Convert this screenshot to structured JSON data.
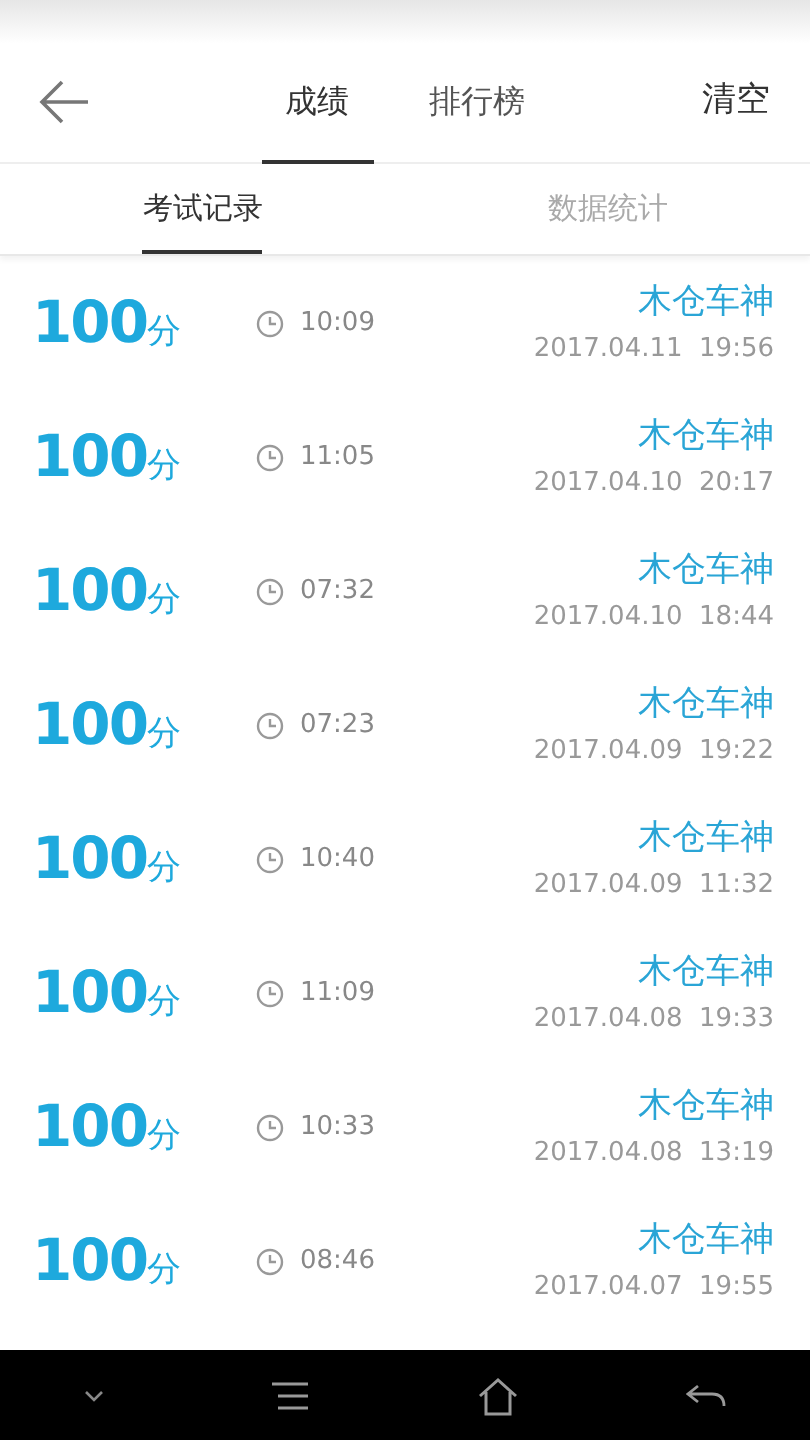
{
  "header": {
    "tabs": [
      {
        "label": "成绩",
        "selected": true
      },
      {
        "label": "排行榜",
        "selected": false
      }
    ],
    "action": "清空"
  },
  "subtabs": [
    {
      "label": "考试记录",
      "selected": true
    },
    {
      "label": "数据统计",
      "selected": false
    }
  ],
  "records": [
    {
      "score": "100",
      "unit": "分",
      "duration": "10:09",
      "name": "木仓车神",
      "time": "2017.04.11  19:56"
    },
    {
      "score": "100",
      "unit": "分",
      "duration": "11:05",
      "name": "木仓车神",
      "time": "2017.04.10  20:17"
    },
    {
      "score": "100",
      "unit": "分",
      "duration": "07:32",
      "name": "木仓车神",
      "time": "2017.04.10  18:44"
    },
    {
      "score": "100",
      "unit": "分",
      "duration": "07:23",
      "name": "木仓车神",
      "time": "2017.04.09  19:22"
    },
    {
      "score": "100",
      "unit": "分",
      "duration": "10:40",
      "name": "木仓车神",
      "time": "2017.04.09  11:32"
    },
    {
      "score": "100",
      "unit": "分",
      "duration": "11:09",
      "name": "木仓车神",
      "time": "2017.04.08  19:33"
    },
    {
      "score": "100",
      "unit": "分",
      "duration": "10:33",
      "name": "木仓车神",
      "time": "2017.04.08  13:19"
    },
    {
      "score": "100",
      "unit": "分",
      "duration": "08:46",
      "name": "木仓车神",
      "time": "2017.04.07  19:55"
    }
  ]
}
